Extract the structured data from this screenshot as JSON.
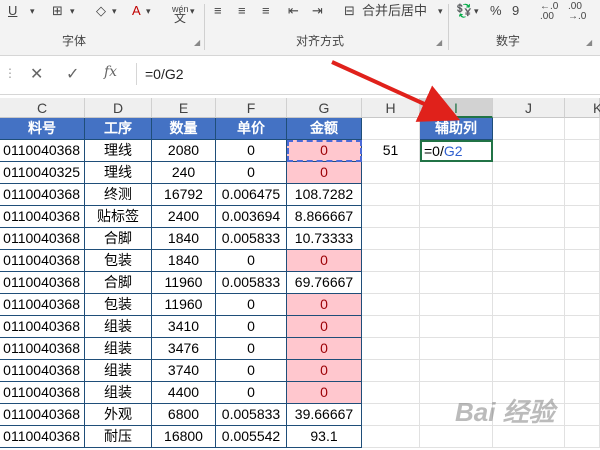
{
  "ribbon": {
    "underline": "U",
    "font_color": "A",
    "wen_label": "wén",
    "wen_char": "文",
    "merge_label": "合并后居中",
    "percent": "%",
    "comma": "9",
    "groups": [
      "字体",
      "对齐方式",
      "数字"
    ]
  },
  "formula_bar": {
    "cancel": "✕",
    "confirm": "✓",
    "fx": "fx",
    "value": "=0/G2"
  },
  "columns": [
    "C",
    "D",
    "E",
    "F",
    "G",
    "H",
    "I",
    "J",
    "K"
  ],
  "table": {
    "headers": [
      "料号",
      "工序",
      "数量",
      "单价",
      "金额"
    ],
    "rows": [
      [
        "0110040368",
        "理线",
        "2080",
        "0",
        "0"
      ],
      [
        "0110040325",
        "理线",
        "240",
        "0",
        "0"
      ],
      [
        "0110040368",
        "终测",
        "16792",
        "0.006475",
        "108.7282"
      ],
      [
        "0110040368",
        "贴标签",
        "2400",
        "0.003694",
        "8.866667"
      ],
      [
        "0110040368",
        "合脚",
        "1840",
        "0.005833",
        "10.73333"
      ],
      [
        "0110040368",
        "包装",
        "1840",
        "0",
        "0"
      ],
      [
        "0110040368",
        "合脚",
        "11960",
        "0.005833",
        "69.76667"
      ],
      [
        "0110040368",
        "包装",
        "11960",
        "0",
        "0"
      ],
      [
        "0110040368",
        "组装",
        "3410",
        "0",
        "0"
      ],
      [
        "0110040368",
        "组装",
        "3476",
        "0",
        "0"
      ],
      [
        "0110040368",
        "组装",
        "3740",
        "0",
        "0"
      ],
      [
        "0110040368",
        "组装",
        "4400",
        "0",
        "0"
      ],
      [
        "0110040368",
        "外观",
        "6800",
        "0.005833",
        "39.66667"
      ],
      [
        "0110040368",
        "耐压",
        "16800",
        "0.005542",
        "93.1"
      ]
    ]
  },
  "helper": {
    "header": "辅助列",
    "h2": "51",
    "formula_prefix": "=0/",
    "formula_ref": "G2"
  },
  "watermark": "Bai 经验"
}
